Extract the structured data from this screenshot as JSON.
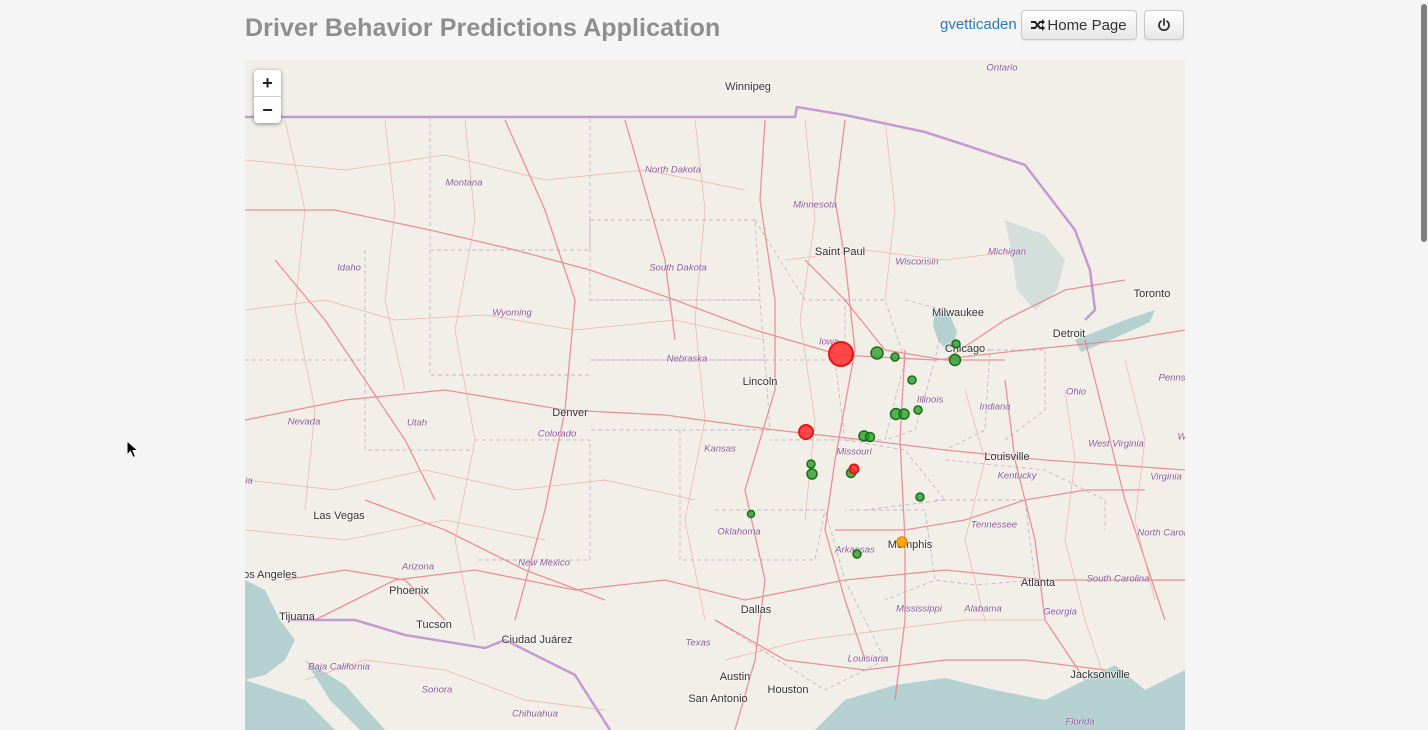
{
  "header": {
    "title": "Driver Behavior Predictions Application",
    "user": "gvetticaden",
    "home_label": "Home Page",
    "home_icon": "shuffle-icon",
    "power_icon": "power-icon"
  },
  "map": {
    "zoom_in": "+",
    "zoom_out": "−",
    "cities": [
      "Winnipeg",
      "Saint Paul",
      "Milwaukee",
      "Chicago",
      "Detroit",
      "Toronto",
      "Lincoln",
      "Denver",
      "Louisville",
      "Las Vegas",
      "Memphis",
      "Atlanta",
      "Dallas",
      "Austin",
      "Houston",
      "San Antonio",
      "Jacksonville",
      "Phoenix",
      "Tucson",
      "Tijuana",
      "Ciudad Juárez",
      "os Angeles"
    ],
    "regions": [
      "Ontario",
      "North Dakota",
      "Minnesota",
      "Montana",
      "South Dakota",
      "Wisconsin",
      "Michigan",
      "Idaho",
      "Wyoming",
      "Nebraska",
      "Iowa",
      "Illinois",
      "Indiana",
      "Ohio",
      "Penns",
      "Nevada",
      "Utah",
      "Colorado",
      "Kansas",
      "Missouri",
      "West Virginia",
      "Kentucky",
      "Virginia",
      "W",
      "ia",
      "Oklahoma",
      "Tennessee",
      "North Carolina",
      "Arizona",
      "New Mexico",
      "Arkansas",
      "South Carolina",
      "Mississippi",
      "Alabama",
      "Georgia",
      "Texas",
      "Louisiana",
      "Baja California",
      "Sonora",
      "Chihuahua",
      "Florida"
    ],
    "markers": [
      {
        "color": "#ff2a2a",
        "level": "high"
      },
      {
        "color": "#ff2a2a",
        "level": "medium"
      },
      {
        "color": "#ff2a2a",
        "level": "low"
      },
      {
        "color": "#ffa500",
        "level": "warning"
      },
      {
        "color": "#1f9a1f",
        "level": "normal"
      }
    ],
    "colors": {
      "land": "#f2efe9",
      "water": "#b5d0d0",
      "road": "#e8828a",
      "border": "#c49ad0"
    }
  }
}
